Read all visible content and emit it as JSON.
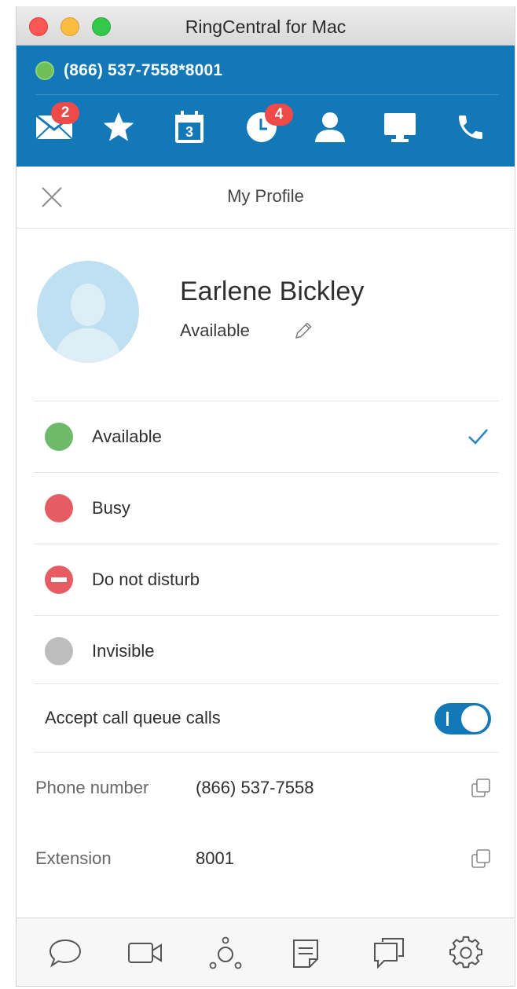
{
  "window": {
    "title": "RingCentral for Mac"
  },
  "account": {
    "phone": "(866) 537-7558*8001"
  },
  "nav": {
    "items": [
      {
        "name": "messages-icon",
        "badge": "2"
      },
      {
        "name": "favorites-star-icon"
      },
      {
        "name": "calendar-icon",
        "day": "3"
      },
      {
        "name": "call-history-icon",
        "badge": "4"
      },
      {
        "name": "contacts-icon"
      },
      {
        "name": "meetings-screen-icon"
      },
      {
        "name": "phone-icon"
      }
    ]
  },
  "header": {
    "title": "My Profile"
  },
  "profile": {
    "name": "Earlene Bickley",
    "presence": "Available"
  },
  "statuses": [
    {
      "label": "Available",
      "color": "#6fba6a",
      "selected": true
    },
    {
      "label": "Busy",
      "color": "#e55c63",
      "selected": false
    },
    {
      "label": "Do not disturb",
      "color": "#e55c63",
      "selected": false
    },
    {
      "label": "Invisible",
      "color": "#bdbdbd",
      "selected": false
    }
  ],
  "call_queue": {
    "label": "Accept call queue calls",
    "enabled": true
  },
  "info": [
    {
      "label": "Phone number",
      "value": "(866) 537-7558"
    },
    {
      "label": "Extension",
      "value": "8001"
    }
  ],
  "bottom_bar": {
    "icons": [
      "chat-bubble-icon",
      "video-camera-icon",
      "glip-people-icon",
      "notes-icon",
      "conversations-icon",
      "settings-gear-icon"
    ]
  },
  "colors": {
    "brand": "#1278b8",
    "badge": "#ef4a4a",
    "check": "#2b86c5"
  }
}
